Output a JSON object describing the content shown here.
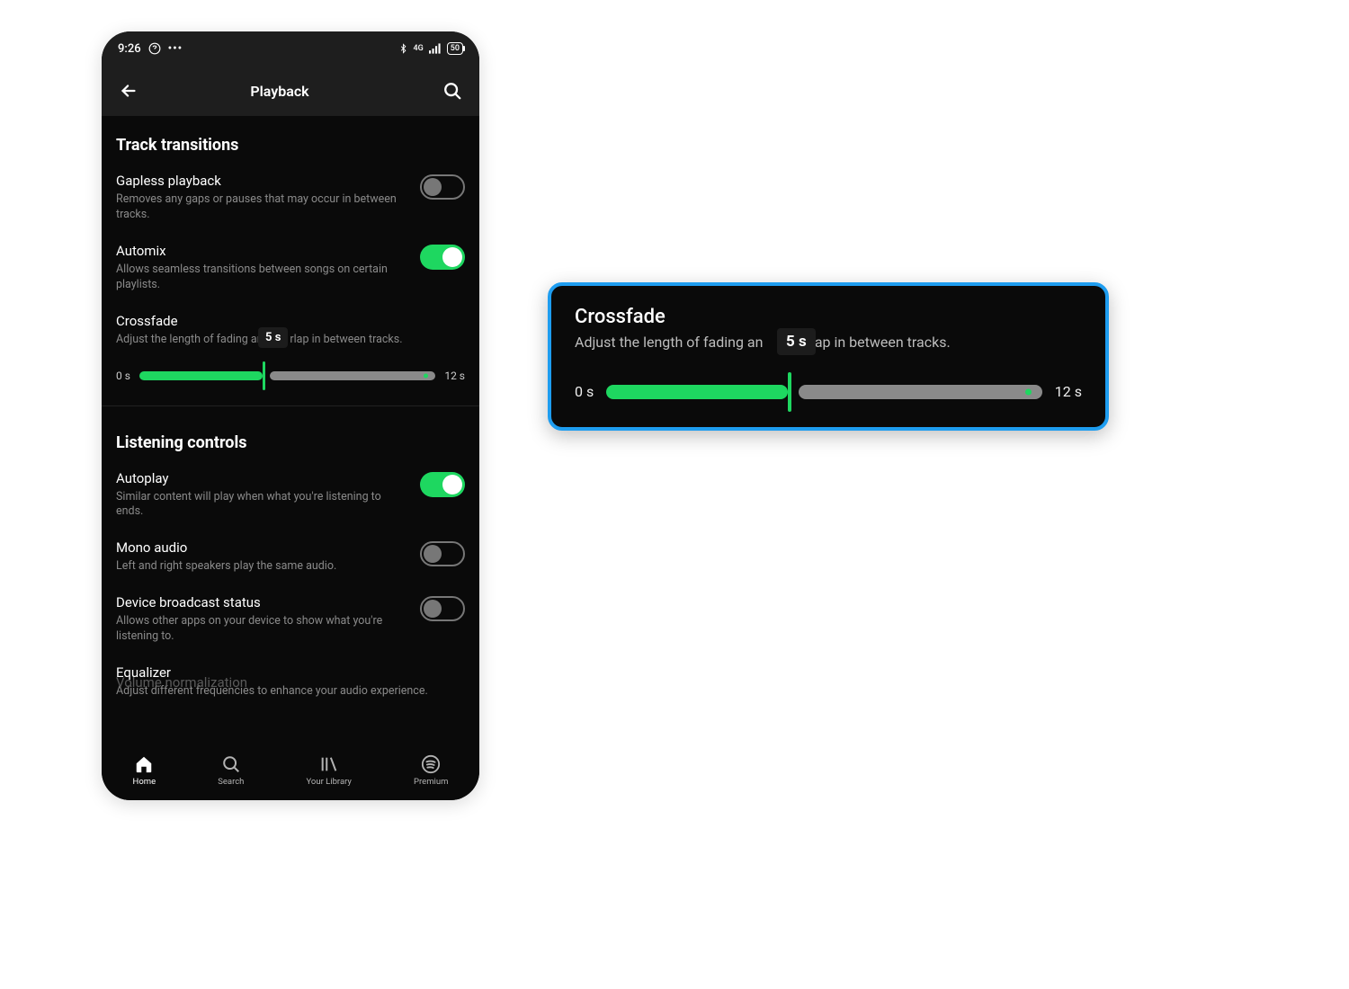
{
  "statusbar": {
    "time": "9:26",
    "network_label": "4G",
    "battery_label": "50"
  },
  "header": {
    "title": "Playback"
  },
  "sections": {
    "track_transitions": {
      "title": "Track transitions",
      "gapless": {
        "label": "Gapless playback",
        "desc": "Removes any gaps or pauses that may occur in between tracks.",
        "on": false
      },
      "automix": {
        "label": "Automix",
        "desc": "Allows seamless transitions between songs on certain playlists.",
        "on": true
      },
      "crossfade": {
        "label": "Crossfade",
        "desc_pre": "Adjust the length of fading an",
        "desc_post": "rlap in between tracks.",
        "tooltip": "5 s",
        "min_label": "0 s",
        "max_label": "12 s",
        "value_sec": 5,
        "max_sec": 12
      }
    },
    "listening_controls": {
      "title": "Listening controls",
      "autoplay": {
        "label": "Autoplay",
        "desc": "Similar content will play when what you're listening to ends.",
        "on": true
      },
      "mono": {
        "label": "Mono audio",
        "desc": "Left and right speakers play the same audio.",
        "on": false
      },
      "broadcast": {
        "label": "Device broadcast status",
        "desc": "Allows other apps on your device to show what you're listening to.",
        "on": false
      },
      "equalizer": {
        "label": "Equalizer",
        "desc": "Adjust different frequencies to enhance your audio experience."
      },
      "volnorm_cutoff": "Volume normalization"
    }
  },
  "nav": {
    "home": "Home",
    "search": "Search",
    "library": "Your Library",
    "premium": "Premium"
  },
  "callout": {
    "label": "Crossfade",
    "desc_pre": "Adjust the length of fading an",
    "desc_post": "rlap in between tracks.",
    "tooltip": "5 s",
    "min_label": "0 s",
    "max_label": "12 s",
    "value_sec": 5,
    "max_sec": 12
  }
}
